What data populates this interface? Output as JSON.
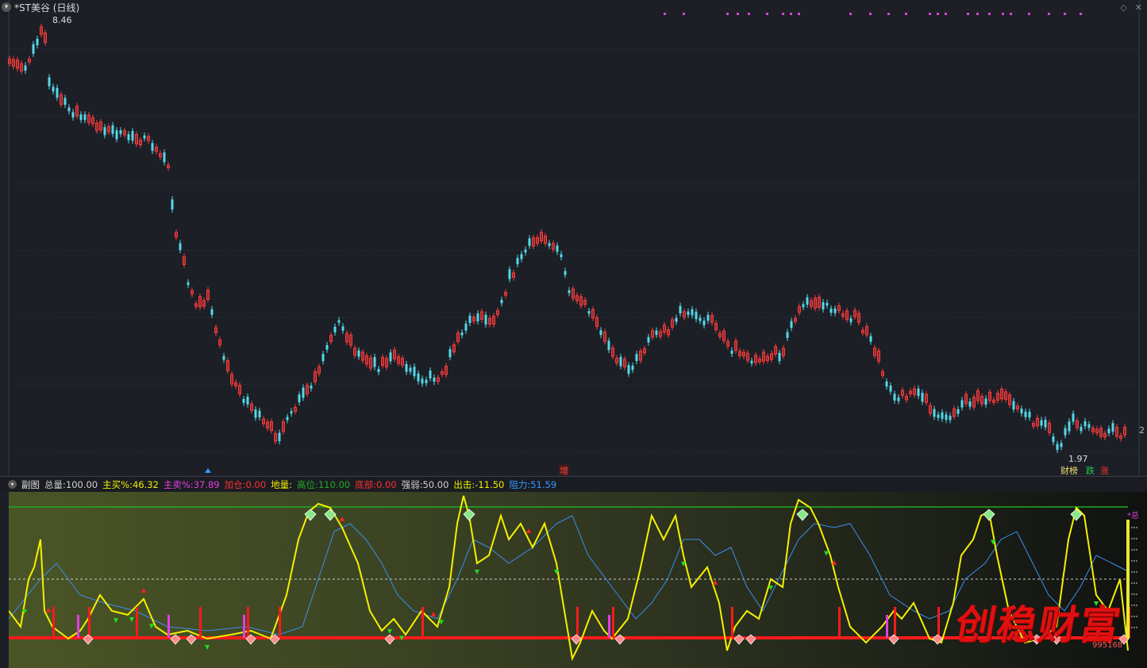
{
  "window": {
    "title": "*ST美谷 (日线)",
    "icons": [
      "diamond-icon",
      "close-icon"
    ]
  },
  "main_chart": {
    "high_label": "8.46",
    "low_label": "1.97",
    "right_axis_label": "2",
    "marker_label": "增",
    "badges": [
      {
        "text": "财榜",
        "color": "#f0e070"
      },
      {
        "text": "跌",
        "color": "#22cc44"
      },
      {
        "text": "涨",
        "color": "#ff3030"
      }
    ],
    "colors": {
      "up": "#ff3b3b",
      "down": "#54d8e8",
      "grid": "#2b2f3a"
    }
  },
  "sub_header": {
    "name": "副图",
    "items": [
      {
        "label": "总量:",
        "value": "100.00",
        "color": "#d0d0d0"
      },
      {
        "label": "主买%:",
        "value": "46.32",
        "color": "#f0f000"
      },
      {
        "label": "主卖%:",
        "value": "37.89",
        "color": "#e040e0"
      },
      {
        "label": "加仓:",
        "value": "0.00",
        "color": "#ff3030"
      },
      {
        "label": "地量:",
        "value": "",
        "color": "#f0f000"
      },
      {
        "label": "高位:",
        "value": "110.00",
        "color": "#22aa22"
      },
      {
        "label": "底部:",
        "value": "0.00",
        "color": "#ff3030"
      },
      {
        "label": "强弱:",
        "value": "50.00",
        "color": "#d0d0d0"
      },
      {
        "label": "出击:",
        "value": "-11.50",
        "color": "#f0f000"
      },
      {
        "label": "阻力:",
        "value": "51.59",
        "color": "#3399ff"
      }
    ]
  },
  "sub_chart": {
    "right_label": "*总",
    "colors": {
      "main_line": "#f4f000",
      "blue_line": "#3a8ef0",
      "high_line": "#22aa22",
      "base_line": "#ff1a1a",
      "magenta": "#e040e0"
    }
  },
  "watermark": {
    "text": "创稳财富",
    "code": "995168"
  }
}
